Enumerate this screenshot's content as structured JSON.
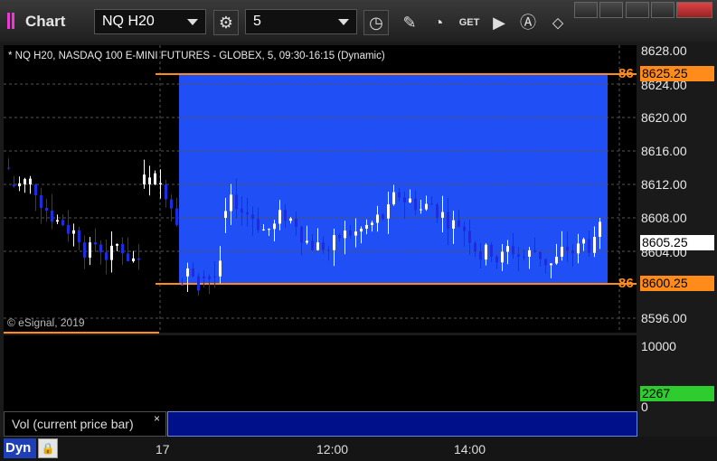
{
  "window": {
    "app_title": "Chart",
    "symbol": "NQ H20",
    "interval": "5"
  },
  "chart": {
    "legend": "* NQ H20, NASDAQ 100 E-MINI FUTURES - GLOBEX, 5, 09:30-16:15 (Dynamic)",
    "copyright": "© eSignal, 2019",
    "price_ticks": [
      "8628.00",
      "8624.00",
      "8620.00",
      "8616.00",
      "8612.00",
      "8608.00",
      "8604.00",
      "8596.00"
    ],
    "upper_level": "8625.25",
    "lower_level": "8600.25",
    "last_price": "8605.25",
    "orange_label": "86",
    "colors": {
      "range_fill": "#1f4ff5",
      "level_line": "#ff8c1a",
      "up_candle": "#ffffff",
      "down_candle": "#1a2ee0",
      "vol_up": "#43d62d",
      "vol_down": "#e23030",
      "last_price_bg": "#ffffff",
      "vol_last_bg": "#2ecc2e"
    }
  },
  "volume": {
    "label": "Vol (current price bar)",
    "close": "×",
    "ticks": [
      "10000",
      "0"
    ],
    "last_value": "2267"
  },
  "time_axis": {
    "labels": [
      "17",
      "12:00",
      "14:00"
    ],
    "mode_button": "Dyn"
  }
}
